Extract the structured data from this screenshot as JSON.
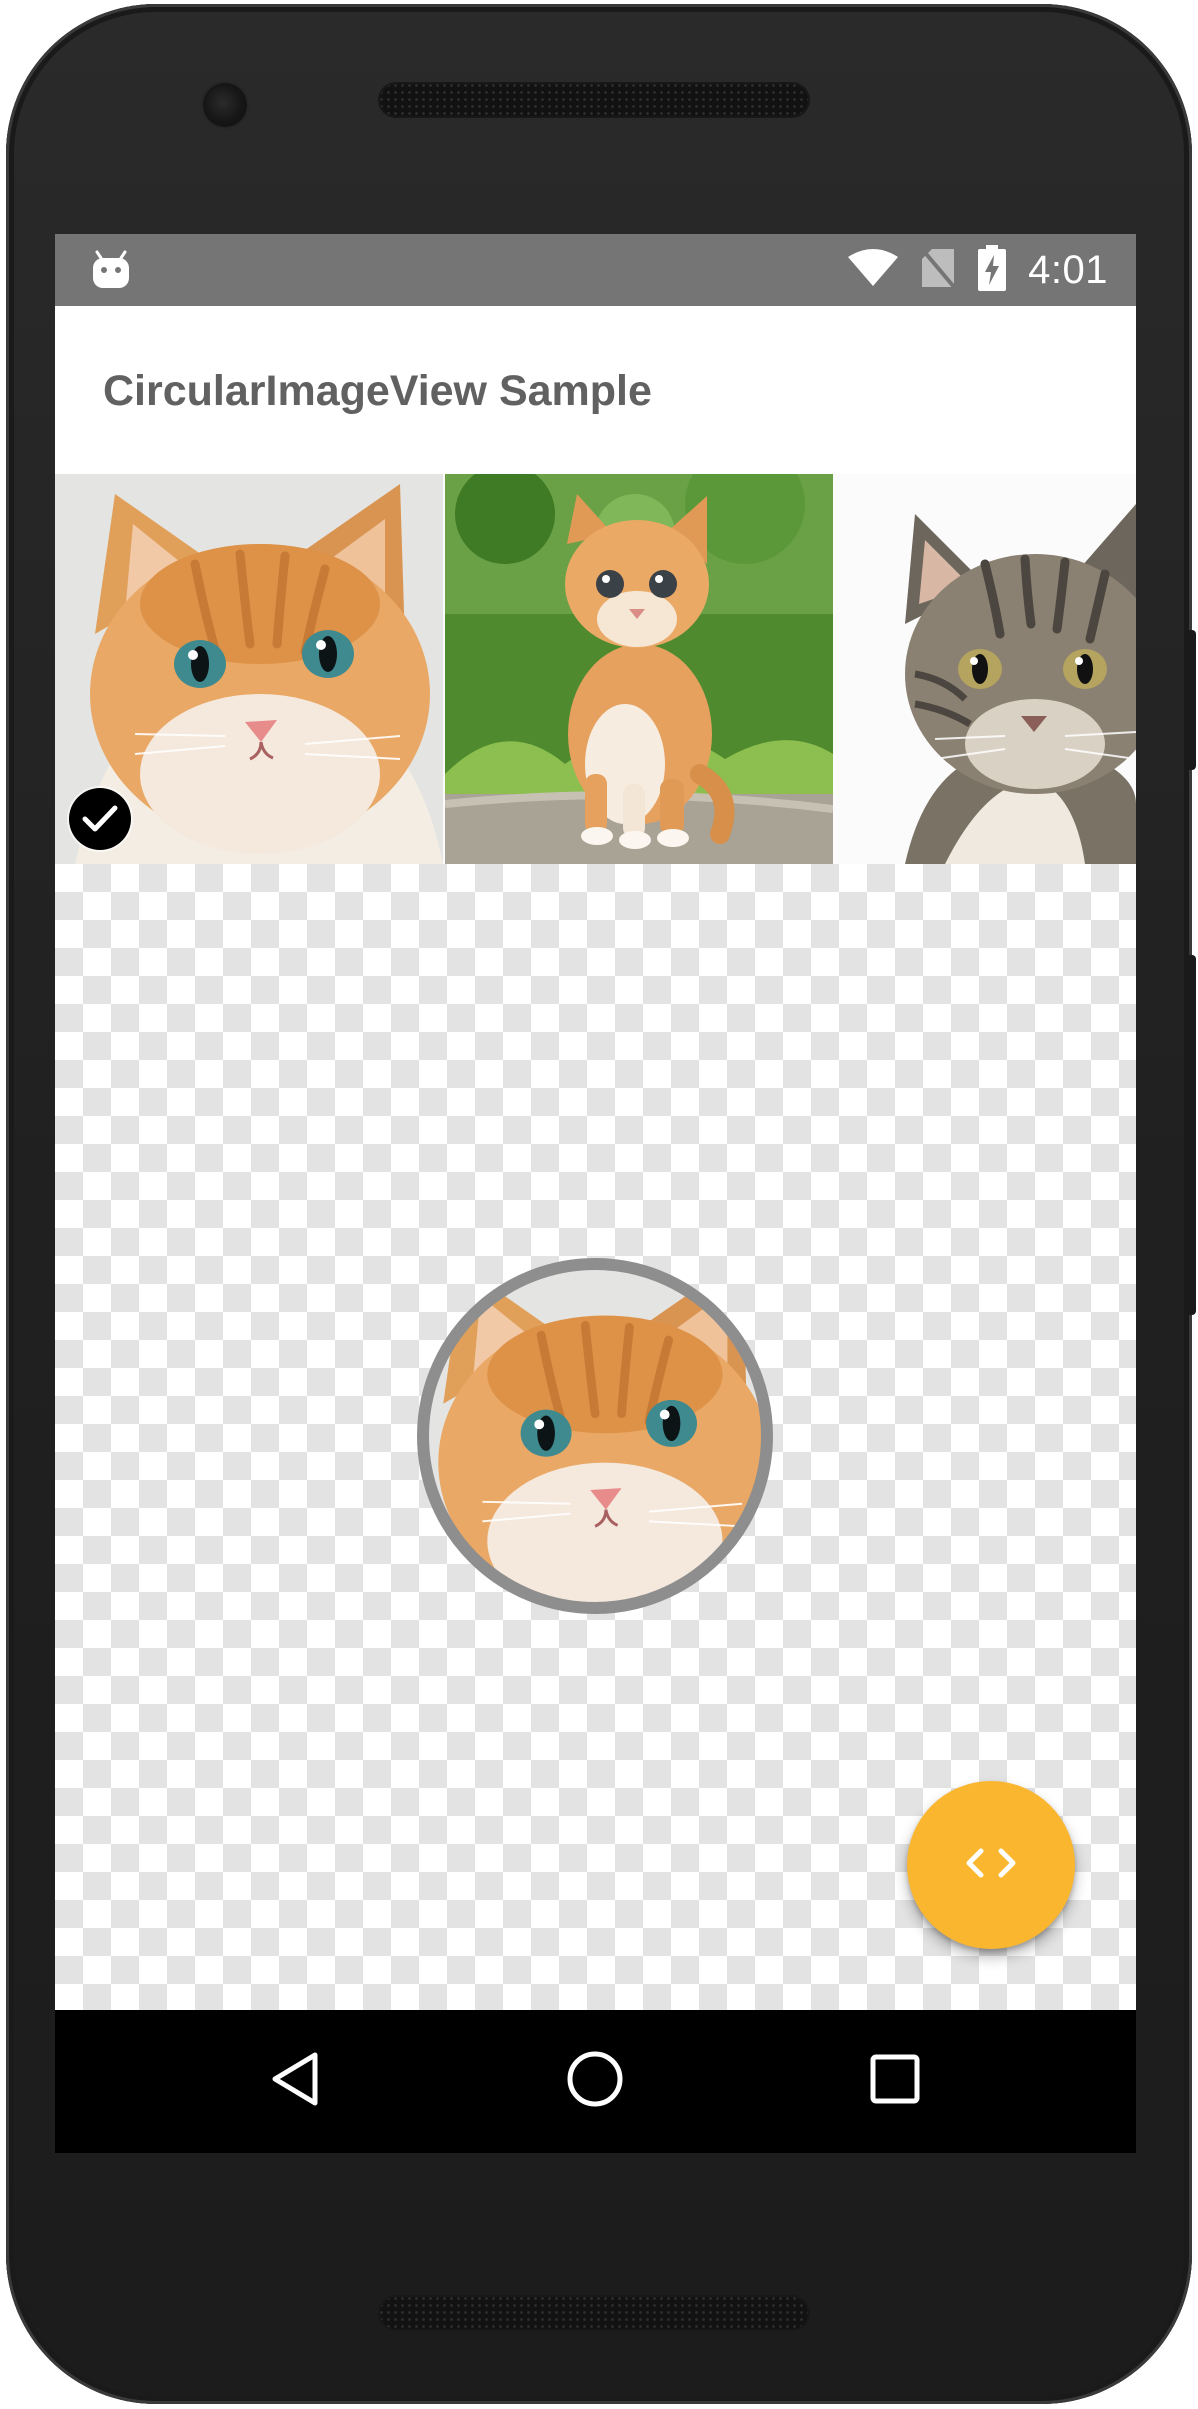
{
  "status_bar": {
    "time": "4:01",
    "icons": [
      "android-debug-icon",
      "wifi-icon",
      "no-sim-icon",
      "battery-charging-icon"
    ]
  },
  "app_bar": {
    "title": "CircularImageView Sample"
  },
  "gallery": {
    "items": [
      {
        "name": "kitten-closeup",
        "selected": true
      },
      {
        "name": "kitten-on-grass",
        "selected": false
      },
      {
        "name": "tabby-cat",
        "selected": false
      }
    ]
  },
  "circular_view": {
    "image": "kitten-closeup",
    "border_color": "#8e8e8e"
  },
  "fab": {
    "icon": "code-icon",
    "color": "#fbb630"
  },
  "nav_bar": {
    "buttons": [
      "back-icon",
      "home-icon",
      "recents-icon"
    ]
  },
  "colors": {
    "status_bar": "#757575",
    "title_text": "#616161",
    "checker": "#e3e3e3"
  }
}
